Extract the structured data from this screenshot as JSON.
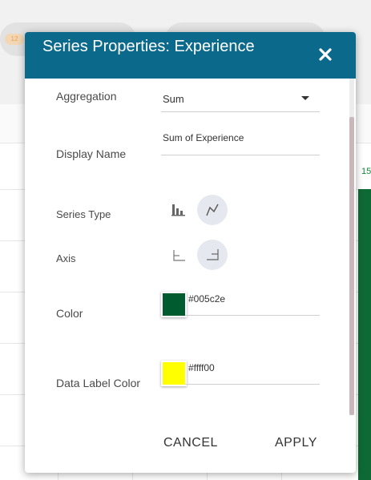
{
  "background": {
    "badge_text": "12",
    "value_label": "15"
  },
  "modal": {
    "title": "Series Properties: Experience",
    "close_icon": "close-icon",
    "aggregation": {
      "label": "Aggregation",
      "value": "Sum"
    },
    "display_name": {
      "label": "Display Name",
      "value": "Sum of Experience"
    },
    "series_type": {
      "label": "Series Type",
      "options": [
        "bar-chart-icon",
        "line-chart-icon"
      ],
      "selected": "line-chart-icon"
    },
    "axis": {
      "label": "Axis",
      "options": [
        "left-axis-icon",
        "right-axis-icon"
      ],
      "selected": "right-axis-icon"
    },
    "color": {
      "label": "Color",
      "value": "#005c2e"
    },
    "data_label_color": {
      "label": "Data Label Color",
      "value": "#ffff00"
    },
    "footer": {
      "cancel_label": "CANCEL",
      "apply_label": "APPLY"
    }
  },
  "colors": {
    "header": "#0b6a8c",
    "series_color": "#005c2e",
    "data_label_color": "#ffff00"
  }
}
